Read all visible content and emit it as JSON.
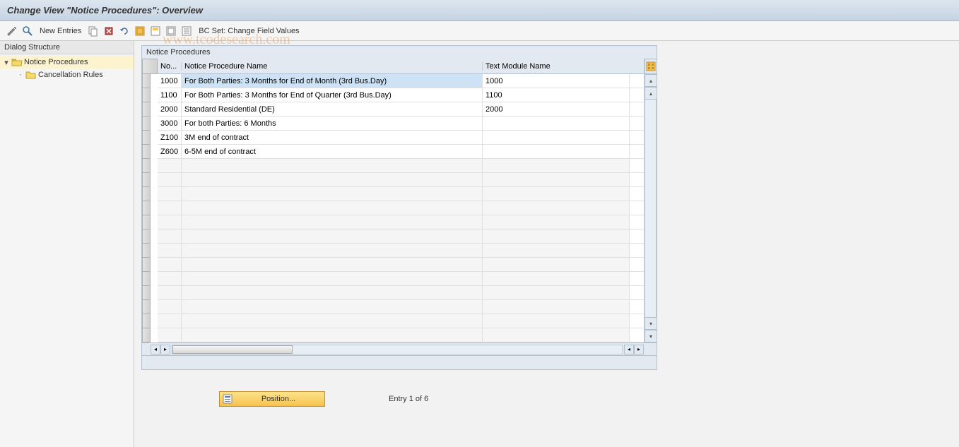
{
  "header": {
    "title": "Change View \"Notice Procedures\": Overview"
  },
  "toolbar": {
    "new_entries": "New Entries",
    "bc_set": "BC Set: Change Field Values"
  },
  "dialog": {
    "title": "Dialog Structure",
    "items": [
      {
        "label": "Notice Procedures",
        "selected": true,
        "icon": "folder-open"
      },
      {
        "label": "Cancellation Rules",
        "selected": false,
        "icon": "folder"
      }
    ]
  },
  "table": {
    "title": "Notice Procedures",
    "cols": {
      "no": "No...",
      "name": "Notice Procedure Name",
      "text": "Text Module Name"
    },
    "rows": [
      {
        "no": "1000",
        "name": "For Both Parties: 3 Months for End of Month (3rd Bus.Day)",
        "text": "1000",
        "selected": true
      },
      {
        "no": "1100",
        "name": "For Both Parties: 3 Months for End of Quarter (3rd Bus.Day)",
        "text": "1100"
      },
      {
        "no": "2000",
        "name": "Standard Residential (DE)",
        "text": "2000"
      },
      {
        "no": "3000",
        "name": "For both Parties: 6 Months",
        "text": ""
      },
      {
        "no": "Z100",
        "name": "3M end of contract",
        "text": ""
      },
      {
        "no": "Z600",
        "name": "6-5M end of contract",
        "text": ""
      }
    ],
    "empty_rows": 13
  },
  "footer": {
    "position": "Position...",
    "entry": "Entry 1 of 6"
  },
  "watermark": "www.tcodesearch.com"
}
